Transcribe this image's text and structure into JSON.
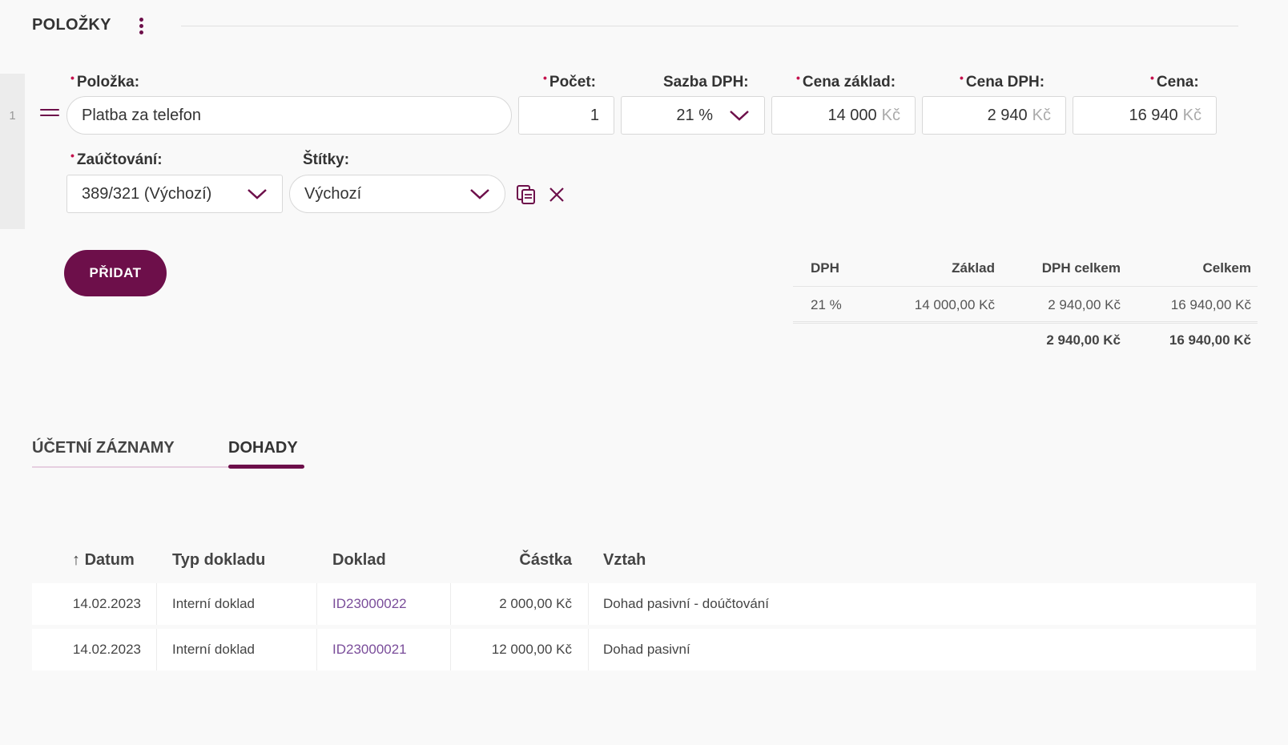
{
  "section": {
    "title": "POLOŽKY"
  },
  "item": {
    "row_number": "1",
    "labels": {
      "item": "Položka:",
      "count": "Počet:",
      "vat_rate": "Sazba DPH:",
      "base_price": "Cena základ:",
      "vat_price": "Cena DPH:",
      "price": "Cena:",
      "accounting": "Zaúčtování:",
      "tags": "Štítky:"
    },
    "values": {
      "item": "Platba za telefon",
      "count": "1",
      "vat_rate": "21 %",
      "base_price": "14 000",
      "vat_price": "2 940",
      "price": "16 940",
      "currency": "Kč",
      "accounting": "389/321 (Výchozí)",
      "tags": "Výchozí"
    }
  },
  "add_button": "PŘIDAT",
  "vat_summary": {
    "headers": [
      "DPH",
      "Základ",
      "DPH celkem",
      "Celkem"
    ],
    "row": [
      "21 %",
      "14 000,00 Kč",
      "2 940,00 Kč",
      "16 940,00 Kč"
    ],
    "totals": [
      "2 940,00 Kč",
      "16 940,00 Kč"
    ]
  },
  "tabs": [
    {
      "label": "ÚČETNÍ ZÁZNAMY",
      "active": false
    },
    {
      "label": "DOHADY",
      "active": true
    }
  ],
  "table": {
    "sort_arrow": "↑",
    "headers": [
      "Datum",
      "Typ dokladu",
      "Doklad",
      "Částka",
      "Vztah"
    ],
    "rows": [
      [
        "14.02.2023",
        "Interní doklad",
        "ID23000022",
        "2 000,00 Kč",
        "Dohad pasivní - doúčtování"
      ],
      [
        "14.02.2023",
        "Interní doklad",
        "ID23000021",
        "12 000,00 Kč",
        "Dohad pasivní"
      ]
    ]
  },
  "colors": {
    "accent": "#6d0f4a",
    "required": "#c4124d",
    "link": "#7a4d9a"
  }
}
